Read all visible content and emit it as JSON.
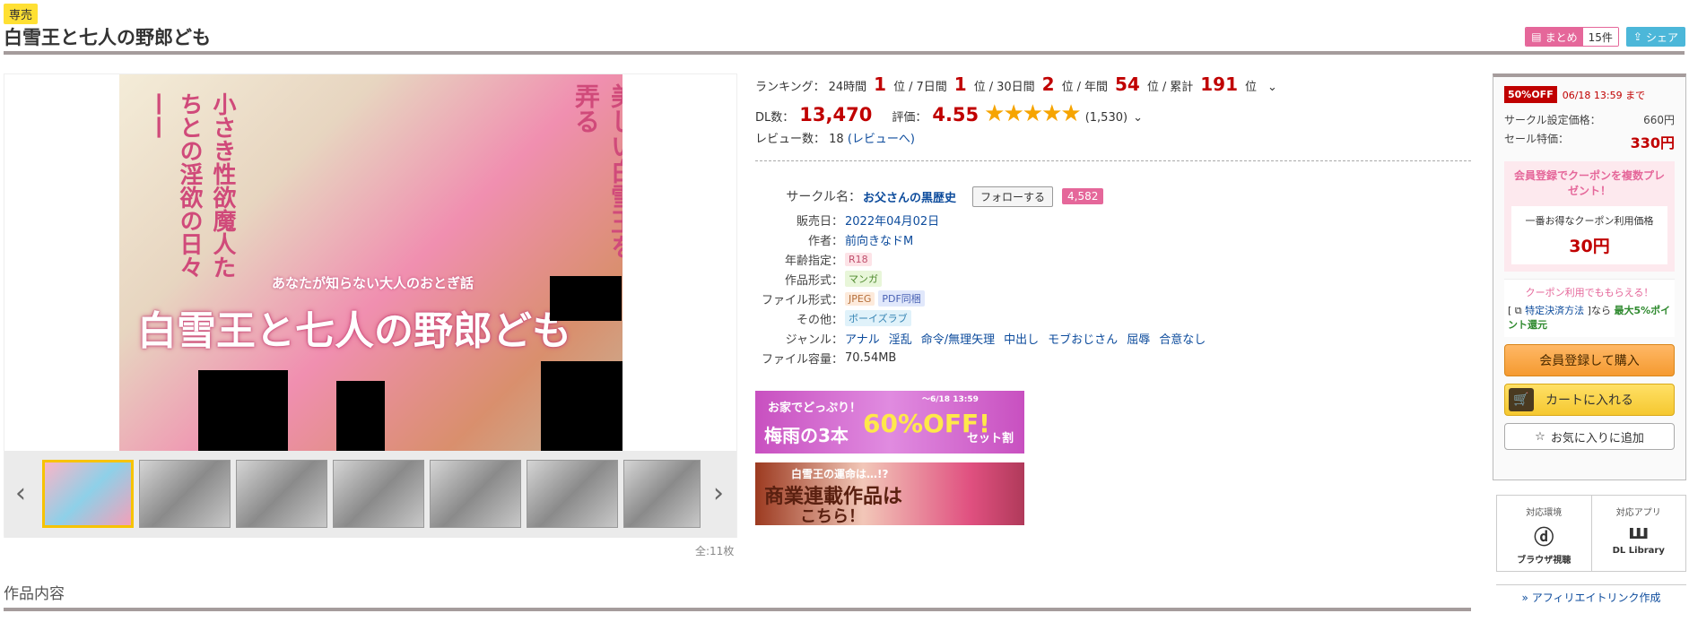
{
  "badge": "専売",
  "title": "白雪王と七人の野郎ども",
  "top_buttons": {
    "matome_label": "まとめ",
    "matome_count": "15件",
    "share_label": "シェア"
  },
  "gallery": {
    "cover_title": "白雪王と七人の野郎ども",
    "cover_subtitle": "あなたが知らない大人のおとぎ話",
    "cover_left_text": "小さき性欲魔人たちとの淫欲の日々——",
    "cover_right_text": "美しい白雪王を弄る",
    "page_count": "全:11枚",
    "prev": "‹",
    "next": "›"
  },
  "ranking": {
    "label": "ランキング：",
    "items": [
      {
        "period": "24時間",
        "rank": "1",
        "unit": "位"
      },
      {
        "period": "7日間",
        "rank": "1",
        "unit": "位"
      },
      {
        "period": "30日間",
        "rank": "2",
        "unit": "位"
      },
      {
        "period": "年間",
        "rank": "54",
        "unit": "位"
      },
      {
        "period": "累計",
        "rank": "191",
        "unit": "位"
      }
    ]
  },
  "stats": {
    "dl_label": "DL数：",
    "dl_count": "13,470",
    "rating_label": "評価：",
    "rating": "4.55",
    "rating_count": "(1,530)",
    "review_label": "レビュー数：",
    "review_count": "18",
    "review_link": "(レビューへ)"
  },
  "spec": {
    "circle_label": "サークル名：",
    "circle_name": "お父さんの黒歴史",
    "follow_label": "フォローする",
    "follow_count": "4,582",
    "release_label": "販売日：",
    "release": "2022年04月02日",
    "author_label": "作者：",
    "author": "前向きなドM",
    "age_label": "年齢指定：",
    "age": "R18",
    "format_label": "作品形式：",
    "format": "マンガ",
    "file_label": "ファイル形式：",
    "file_jpeg": "JPEG",
    "file_pdf": "PDF同梱",
    "other_label": "その他：",
    "other": "ボーイズラブ",
    "genre_label": "ジャンル：",
    "genres": [
      "アナル",
      "淫乱",
      "命令/無理矢理",
      "中出し",
      "モブおじさん",
      "屈辱",
      "合意なし"
    ],
    "size_label": "ファイル容量：",
    "size": "70.54MB"
  },
  "banners": {
    "b1_top": "お家でどっぷり！",
    "b1_date": "～6/18 13:59",
    "b1_main": "梅雨の3本",
    "b1_off": "60%OFF!",
    "b1_set": "セット割",
    "b2_top": "白雪王の運命は…!?",
    "b2_main": "商業連載作品は",
    "b2_sub": "こちら！"
  },
  "section_title": "作品内容",
  "buy": {
    "off_tag": "50%OFF",
    "off_until": "06/18 13:59 まで",
    "circle_price_label": "サークル設定価格：",
    "circle_price": "660円",
    "sale_label": "セール特価：",
    "sale_price": "330円",
    "coupon_title": "会員登録でクーポンを複数プレゼント！",
    "coupon_inner_label": "一番お得なクーポン利用価格",
    "coupon_price": "30円",
    "pay_title": "クーポン利用でももらえる！",
    "pay_prefix": "[",
    "pay_link": "特定決済方法",
    "pay_mid": "]なら",
    "pay_bonus": "最大5%ポイント還元",
    "buy_button": "会員登録して購入",
    "cart_button": "カートに入れる",
    "fav_button": "お気に入りに追加"
  },
  "env": {
    "env_label": "対応環境",
    "env_name": "ブラウザ視聴",
    "app_label": "対応アプリ",
    "app_name": "DL Library"
  },
  "affiliate": "» アフィリエイトリンク作成"
}
